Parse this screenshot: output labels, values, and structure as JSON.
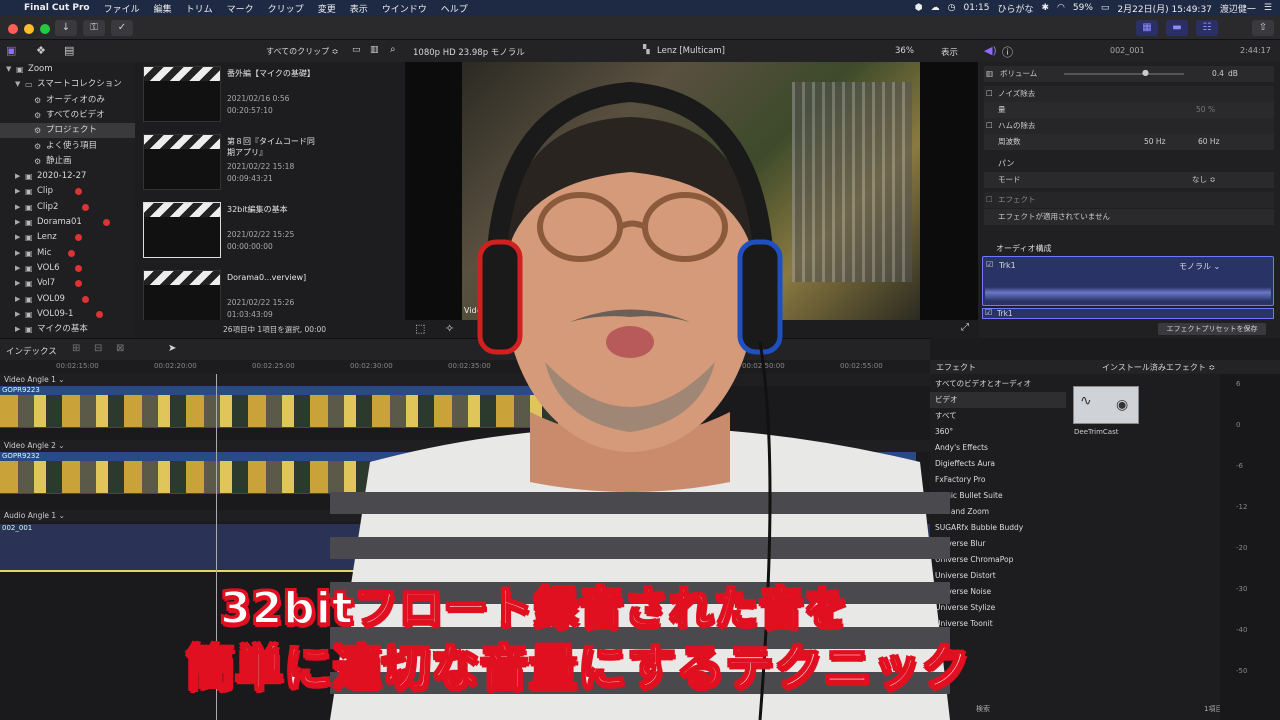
{
  "menubar": {
    "apple": "",
    "app_name": "Final Cut Pro",
    "menus": [
      "ファイル",
      "編集",
      "トリム",
      "マーク",
      "クリップ",
      "変更",
      "表示",
      "ウインドウ",
      "ヘルプ"
    ],
    "time": "01:15",
    "ime": "ひらがな",
    "battery": "59%",
    "datetime": "2月22日(月) 15:49:37",
    "user": "渡辺健一"
  },
  "browser": {
    "filter": "すべてのクリップ ≎",
    "library": [
      {
        "label": "Zoom",
        "level": 0,
        "icon": "library-icon",
        "tri": "▼"
      },
      {
        "label": "スマートコレクション",
        "level": 1,
        "icon": "folder-icon",
        "tri": "▼"
      },
      {
        "label": "オーディオのみ",
        "level": 2,
        "icon": "gear-icon"
      },
      {
        "label": "すべてのビデオ",
        "level": 2,
        "icon": "gear-icon"
      },
      {
        "label": "プロジェクト",
        "level": 2,
        "icon": "gear-icon",
        "selected": true
      },
      {
        "label": "よく使う項目",
        "level": 2,
        "icon": "gear-icon"
      },
      {
        "label": "静止画",
        "level": 2,
        "icon": "gear-icon"
      },
      {
        "label": "2020-12-27",
        "level": 1,
        "icon": "event-icon",
        "tri": "▶"
      },
      {
        "label": "Clip",
        "level": 1,
        "icon": "event-icon",
        "tri": "▶",
        "dot": true
      },
      {
        "label": "Clip2",
        "level": 1,
        "icon": "event-icon",
        "tri": "▶",
        "dot": true
      },
      {
        "label": "Dorama01",
        "level": 1,
        "icon": "event-icon",
        "tri": "▶",
        "dot": true
      },
      {
        "label": "Lenz",
        "level": 1,
        "icon": "event-icon",
        "tri": "▶",
        "dot": true
      },
      {
        "label": "Mic",
        "level": 1,
        "icon": "event-icon",
        "tri": "▶",
        "dot": true
      },
      {
        "label": "VOL6",
        "level": 1,
        "icon": "event-icon",
        "tri": "▶",
        "dot": true
      },
      {
        "label": "Vol7",
        "level": 1,
        "icon": "event-icon",
        "tri": "▶",
        "dot": true
      },
      {
        "label": "VOL09",
        "level": 1,
        "icon": "event-icon",
        "tri": "▶",
        "dot": true
      },
      {
        "label": "VOL09-1",
        "level": 1,
        "icon": "event-icon",
        "tri": "▶",
        "dot": true
      },
      {
        "label": "マイクの基本",
        "level": 1,
        "icon": "event-icon",
        "tri": "▶"
      }
    ],
    "clips": [
      {
        "name": "番外編【マイクの基礎】",
        "date": "2021/02/16 0:56",
        "duration": "00:20:57:10",
        "selected": false
      },
      {
        "name": "第８回『タイムコード同期アプリ』",
        "date": "2021/02/22 15:18",
        "duration": "00:09:43:21",
        "selected": false
      },
      {
        "name": "32bit編集の基本",
        "date": "2021/02/22 15:25",
        "duration": "00:00:00:00",
        "selected": true
      },
      {
        "name": "Dorama0...verview]",
        "date": "2021/02/22 15:26",
        "duration": "01:03:43:09",
        "selected": false
      }
    ],
    "status": "26項目中 1項目を選択, 00:00"
  },
  "viewer": {
    "format": "1080p HD 23.98p モノラル",
    "title": "Lenz [Multicam]",
    "zoom": "36%",
    "view": "表示",
    "overlay": "Vide"
  },
  "inspector": {
    "clip_name": "002_001",
    "duration": "2:44:17",
    "volume_label": "ボリューム",
    "volume_value": "0.4",
    "volume_unit": "dB",
    "noise_label": "ノイズ除去",
    "amount_label": "量",
    "amount_value": "50",
    "amount_unit": "%",
    "hum_label": "ハムの除去",
    "freq_label": "周波数",
    "freq_50": "50 Hz",
    "freq_60": "60 Hz",
    "pan_label": "パン",
    "mode_label": "モード",
    "mode_value": "なし ≎",
    "effects_label": "エフェクト",
    "no_effects": "エフェクトが適用されていません",
    "audio_config": "オーディオ構成",
    "trk1": "Trk1",
    "mono": "モノラル ⌄",
    "trk1_b": "Trk1",
    "save_preset": "エフェクトプリセットを保存"
  },
  "timeline": {
    "index_label": "インデックス",
    "ruler": [
      "00:02:15:00",
      "00:02:20:00",
      "00:02:25:00",
      "00:02:30:00",
      "00:02:35:00",
      "00:02:40:00",
      "00:02:45:00",
      "00:02:50:00",
      "00:02:55:00"
    ],
    "tracks": [
      {
        "label": "Video Angle 1 ⌄",
        "clip": "GOPR9223"
      },
      {
        "label": "Video Angle 2 ⌄",
        "clip": "GOPR9232"
      },
      {
        "label": "Audio Angle 1 ⌄",
        "clip": "002_001"
      }
    ]
  },
  "effects": {
    "header": "エフェクト",
    "installed": "インストール済みエフェクト ≎",
    "categories": [
      "すべてのビデオとオーディオ",
      "ビデオ",
      "すべて",
      "360°",
      "Andy's Effects",
      "Digieffects Aura",
      "FxFactory Pro",
      "Magic Bullet Suite",
      "Pan and Zoom",
      "SUGARfx Bubble Buddy",
      "Universe Blur",
      "Universe ChromaPop",
      "Universe Distort",
      "Universe Noise",
      "Universe Stylize",
      "Universe Toonit"
    ],
    "selected_index": 1,
    "item_name": "DeeTrimCast",
    "search": "検索",
    "count": "1項目",
    "meter_scale": [
      "6",
      "0",
      "-6",
      "-12",
      "-20",
      "-30",
      "-40",
      "-50"
    ]
  },
  "caption": {
    "line1": "32bitフロート録音された音を",
    "line2": "簡単に適切な音量にするテクニック"
  },
  "colors": {
    "accent": "#7a5cff",
    "menubar": "#1e2a44",
    "caption_outline": "#e01020",
    "audio_track": "#2a3356"
  }
}
